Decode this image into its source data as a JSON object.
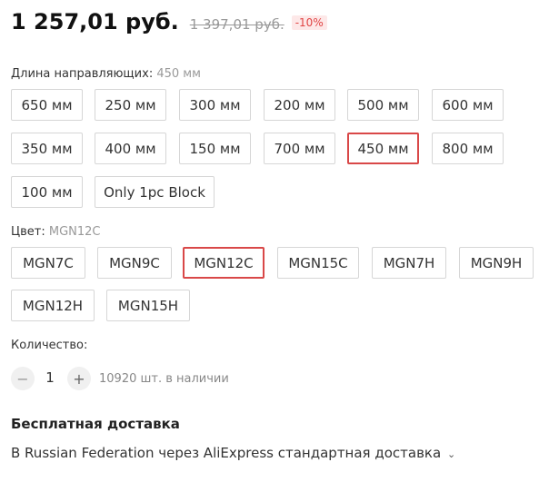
{
  "price": {
    "current": "1 257,01 руб.",
    "original": "1 397,01 руб.",
    "discount": "-10%"
  },
  "length": {
    "label": "Длина направляющих:",
    "selected": "450 мм",
    "options": [
      "650 мм",
      "250 мм",
      "300 мм",
      "200 мм",
      "500 мм",
      "600 мм",
      "350 мм",
      "400 мм",
      "150 мм",
      "700 мм",
      "450 мм",
      "800 мм",
      "100 мм",
      "Only 1pc Block"
    ]
  },
  "color": {
    "label": "Цвет:",
    "selected": "MGN12C",
    "options": [
      "MGN7C",
      "MGN9C",
      "MGN12C",
      "MGN15C",
      "MGN7H",
      "MGN9H",
      "MGN12H",
      "MGN15H"
    ]
  },
  "quantity": {
    "label": "Количество:",
    "decrement": "−",
    "increment": "+",
    "value": "1",
    "stock": "10920 шт. в наличии"
  },
  "shipping": {
    "title": "Бесплатная доставка",
    "description": "В Russian Federation через AliExpress стандартная доставка",
    "chevron": "⌄"
  }
}
